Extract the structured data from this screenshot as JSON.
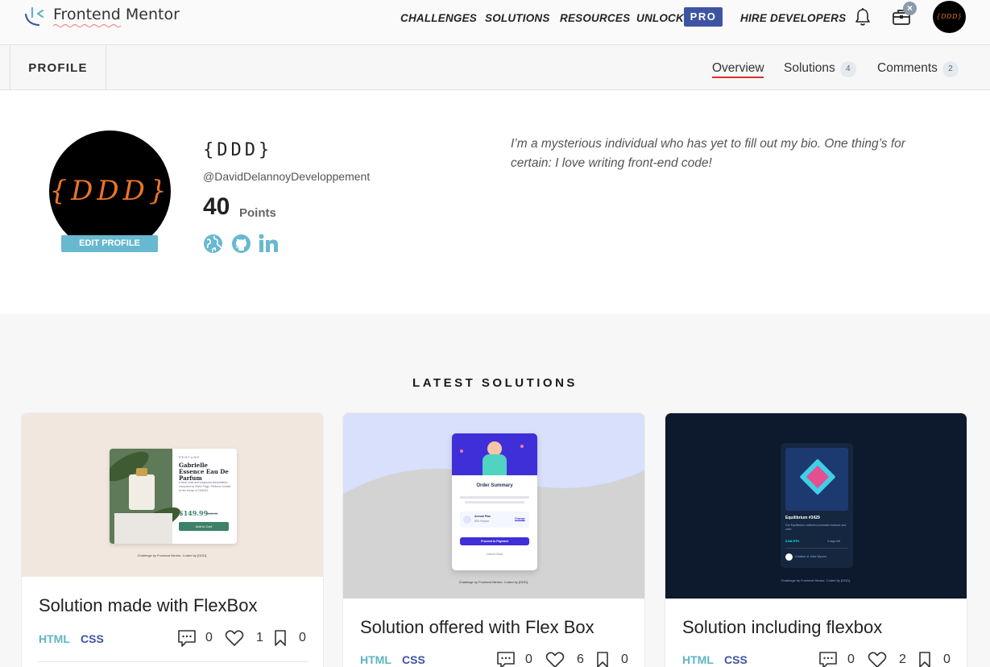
{
  "nav": {
    "logo_text": "Frontend Mentor",
    "links": [
      "CHALLENGES",
      "SOLUTIONS",
      "RESOURCES",
      "UNLOCK",
      "HIRE DEVELOPERS"
    ],
    "pro_badge": "PRO",
    "avatar_text": "{DDD}",
    "icons": [
      "bell-icon",
      "briefcase-icon",
      "close-icon"
    ]
  },
  "tabs": {
    "profile_label": "PROFILE",
    "overview": "Overview",
    "solutions": "Solutions",
    "solutions_count": "4",
    "comments": "Comments",
    "comments_count": "2"
  },
  "profile": {
    "avatar_text": "{DDD}",
    "edit_button": "EDIT PROFILE",
    "name": "{DDD}",
    "handle": "@DavidDelannoyDeveloppement",
    "points": "40",
    "points_label": "Points",
    "bio": "I’m a mysterious individual who has yet to fill out my bio. One thing’s for certain: I love writing front-end code!",
    "social_icons": [
      "globe-icon",
      "github-icon",
      "linkedin-icon"
    ]
  },
  "latest": {
    "title": "LATEST SOLUTIONS",
    "cards": [
      {
        "title": "Solution made with FlexBox",
        "tags": [
          "HTML",
          "CSS"
        ],
        "comments": "0",
        "likes": "1",
        "bookmarks": "0",
        "preview": {
          "category": "PERFUME",
          "product": "Gabrielle Essence Eau De Parfum",
          "description": "A floral, solar and voluptuous interpretation composed by Olivier Polge, Perfumer-Creator for the House of CHANEL.",
          "price": "$149.99",
          "old_price": "$169.99",
          "button": "Add to Cart",
          "attribution": "Challenge by Frontend Mentor. Coded by {DDD}."
        }
      },
      {
        "title": "Solution offered with Flex Box",
        "tags": [
          "HTML",
          "CSS"
        ],
        "comments": "0",
        "likes": "6",
        "bookmarks": "0",
        "preview": {
          "heading": "Order Summary",
          "plan": "Annual Plan",
          "price": "$59.99/year",
          "change": "Change",
          "button": "Proceed to Payment",
          "cancel": "Cancel Order",
          "attribution": "Challenge by Frontend Mentor. Coded by {DDD}."
        }
      },
      {
        "title": "Solution including flexbox",
        "tags": [
          "HTML",
          "CSS"
        ],
        "comments": "0",
        "likes": "2",
        "bookmarks": "0",
        "preview": {
          "heading": "Equilibrium #3429",
          "description": "Our Equilibrium collection promotes balance and calm.",
          "price": "0.041 ETH",
          "time": "3 days left",
          "creator": "Creation of Jules Wyvern",
          "attribution": "Challenge by Frontend Mentor. Coded by {DDD}."
        }
      }
    ]
  },
  "colors": {
    "accent_blue": "#3e54a3",
    "teal": "#68b9cf",
    "tag_html": "#5fb4c6",
    "tag_css": "#3e54a3",
    "tab_underline": "#d5322f",
    "avatar_text": "#e9742a"
  }
}
